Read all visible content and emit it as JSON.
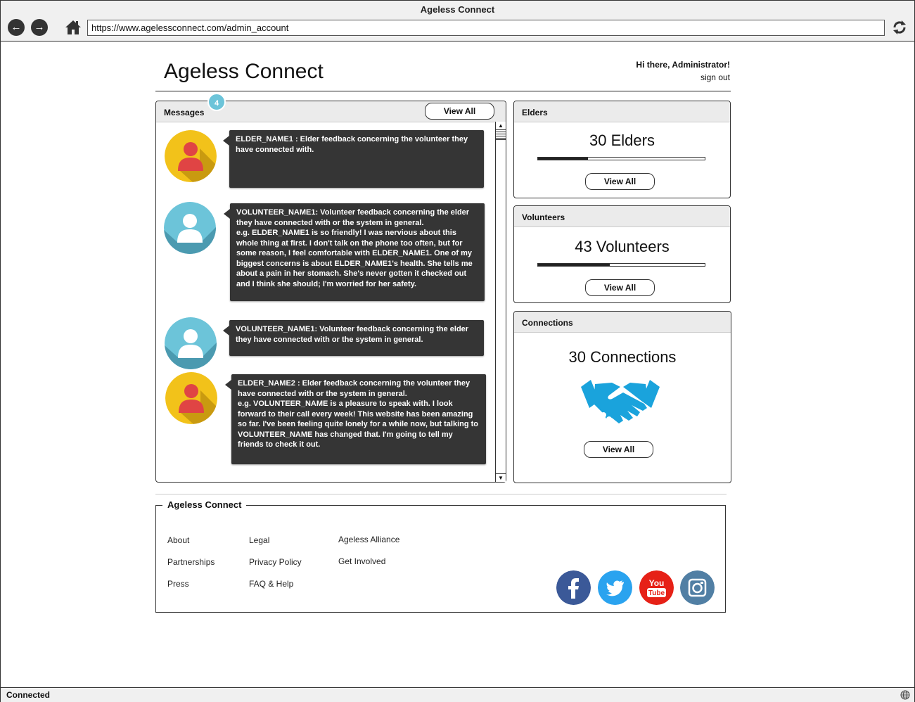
{
  "browser": {
    "window_title": "Ageless Connect",
    "url": "https://www.agelessconnect.com/admin_account",
    "status": "Connected"
  },
  "header": {
    "title": "Ageless Connect",
    "greeting": "Hi there, Administrator!",
    "signout": "sign out"
  },
  "messages": {
    "title": "Messages",
    "badge": "4",
    "view_all": "View All",
    "items": [
      {
        "avatar": "elder-avatar",
        "text": "ELDER_NAME1 : Elder feedback concerning the volunteer they have connected with."
      },
      {
        "avatar": "volunteer-avatar",
        "text": "VOLUNTEER_NAME1: Volunteer feedback concerning the elder they have connected with or the system in general.\ne.g. ELDER_NAME1 is so friendly! I was nervious about this whole thing at first. I don't talk on the phone too often, but for some reason, I feel comfortable with ELDER_NAME1. One of my biggest concerns is about ELDER_NAME1's health. She tells me about a pain in her stomach. She's never gotten it checked out and I think she should; I'm worried for her safety."
      },
      {
        "avatar": "volunteer-avatar",
        "text": "VOLUNTEER_NAME1: Volunteer feedback concerning the elder they have connected with or the system in general."
      },
      {
        "avatar": "elder-avatar",
        "text": "ELDER_NAME2 : Elder feedback concerning the volunteer they have connected with or the system in general.\ne.g. VOLUNTEER_NAME is a pleasure to speak with. I look forward to their call every week! This website has been amazing so far. I've been feeling quite lonely for a while now, but talking to VOLUNTEER_NAME has changed that. I'm going to tell my friends to check it out."
      }
    ]
  },
  "elders": {
    "title": "Elders",
    "count": "30 Elders",
    "progress": 0.3,
    "view_all": "View All"
  },
  "volunteers": {
    "title": "Volunteers",
    "count": "43 Volunteers",
    "progress": 0.43,
    "view_all": "View All"
  },
  "connections": {
    "title": "Connections",
    "count": "30 Connections",
    "icon": "handshake-icon",
    "view_all": "View All"
  },
  "footer": {
    "title": "Ageless Connect",
    "col1": [
      "About",
      "Partnerships",
      "Press"
    ],
    "col2": [
      "Legal",
      "Privacy Policy",
      "FAQ & Help"
    ],
    "col3": [
      "Ageless Alliance",
      "Get Involved"
    ],
    "social": [
      {
        "icon": "facebook-icon",
        "color": "#3b5998"
      },
      {
        "icon": "twitter-icon",
        "color": "#2aa3ef"
      },
      {
        "icon": "youtube-icon",
        "color": "#e62117"
      },
      {
        "icon": "instagram-icon",
        "color": "#517fa4"
      }
    ]
  }
}
